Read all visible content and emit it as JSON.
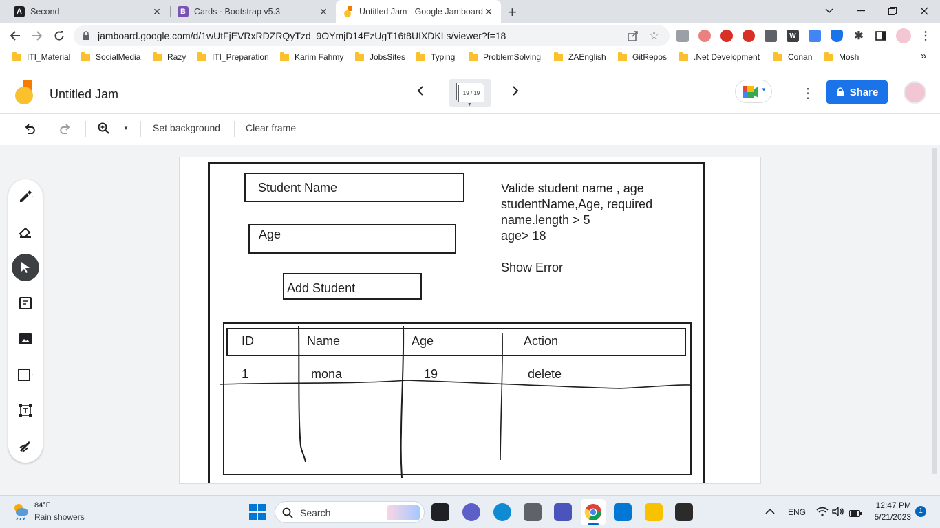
{
  "browser": {
    "tabs": [
      {
        "title": "Second",
        "favicon": "A"
      },
      {
        "title": "Cards · Bootstrap v5.3",
        "favicon": "B"
      },
      {
        "title": "Untitled Jam - Google Jamboard",
        "favicon": "jam"
      }
    ],
    "new_tab_label": "+",
    "url": "jamboard.google.com/d/1wUtFjEVRxRDZRQyTzd_9OYmjD14EzUgT16t8UIXDKLs/viewer?f=18",
    "bookmarks": [
      "ITI_Material",
      "SocialMedia",
      "Razy",
      "ITI_Preparation",
      "Karim Fahmy",
      "JobsSites",
      "Typing",
      "ProblemSolving",
      "ZAEnglish",
      "GitRepos",
      ".Net Development",
      "Conan",
      "Mosh"
    ],
    "bookmarks_overflow": "»",
    "extension_letter": "W"
  },
  "jamboard": {
    "title": "Untitled Jam",
    "frame_counter": "19 / 19",
    "share_label": "Share",
    "tools": {
      "set_background": "Set background",
      "clear_frame": "Clear frame"
    }
  },
  "board": {
    "input_name_label": "Student Name",
    "input_age_label": "Age",
    "add_button_label": "Add Student",
    "notes": [
      "Valide student name , age",
      "studentName,Age, required",
      "name.length > 5",
      "age> 18",
      "Show Error"
    ],
    "table": {
      "headers": [
        "ID",
        "Name",
        "Age",
        "Action"
      ],
      "rows": [
        [
          "1",
          "mona",
          "19",
          "delete"
        ]
      ]
    }
  },
  "taskbar": {
    "weather_temp": "84°F",
    "weather_desc": "Rain showers",
    "search_label": "Search",
    "lang": "ENG",
    "time": "12:47 PM",
    "date": "5/21/2023",
    "notification_count": "1"
  }
}
